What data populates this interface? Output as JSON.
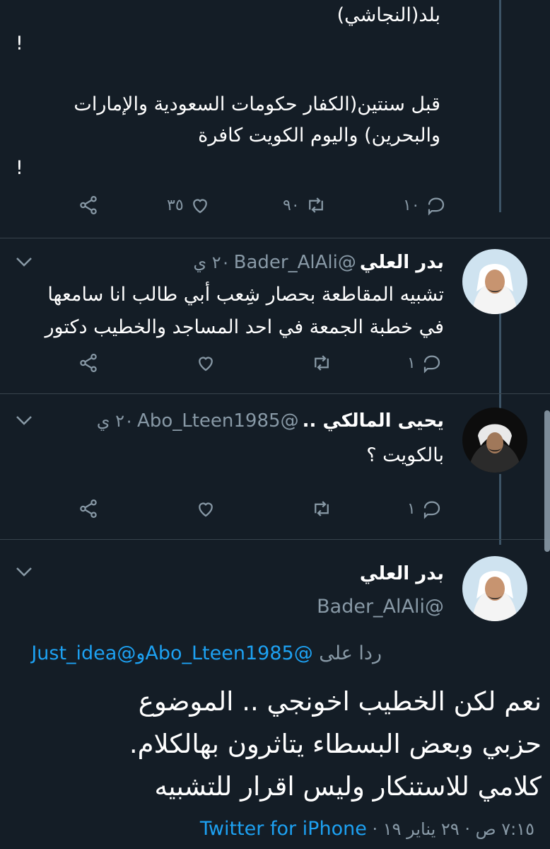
{
  "thread_top": {
    "lines": [
      "بلد(النجاشي)",
      "!",
      "قبل سنتين(الكفار حكومات السعودية والإمارات",
      "والبحرين) واليوم الكويت كافرة",
      "!"
    ],
    "reply_count": "١٠",
    "retweet_count": "٩٠",
    "like_count": "٣٥"
  },
  "tweet1": {
    "name": "بدر العلي",
    "handle": "@Bader_AlAli",
    "time": "٢٠ ي",
    "lines": [
      "تشبيه المقاطعة بحصار شِعب أبي طالب انا سامعها",
      "في خطبة الجمعة في احد المساجد  والخطيب دكتور"
    ],
    "reply_count": "١"
  },
  "tweet2": {
    "name": "يحيى المالكي ..",
    "handle": "@Abo_Lteen1985",
    "time": "٢٠ ي",
    "lines": [
      "بالكويت ؟"
    ],
    "reply_count": "١"
  },
  "main_tweet": {
    "name": "بدر العلي",
    "handle": "@Bader_AlAli",
    "replying_prefix": "ردا على",
    "replying_user1": "@Abo_Lteen1985",
    "replying_and": "و",
    "replying_user2": "@Just_idea",
    "lines": [
      "نعم  لكن الخطيب اخونجي .. الموضوع",
      "حزبي وبعض البسطاء يتاثرون بهالكلام.",
      "كلامي للاستنكار  وليس اقرار للتشبيه"
    ],
    "timestamp": "٧:١٥ ص · ٢٩ يناير ١٩ ·",
    "source": "Twitter for iPhone"
  },
  "icons": [
    "reply-icon",
    "retweet-icon",
    "like-icon",
    "share-icon",
    "chevron-down-icon"
  ],
  "colors": {
    "background": "#141d26",
    "accent": "#1da1f2",
    "muted": "#8899a6"
  }
}
